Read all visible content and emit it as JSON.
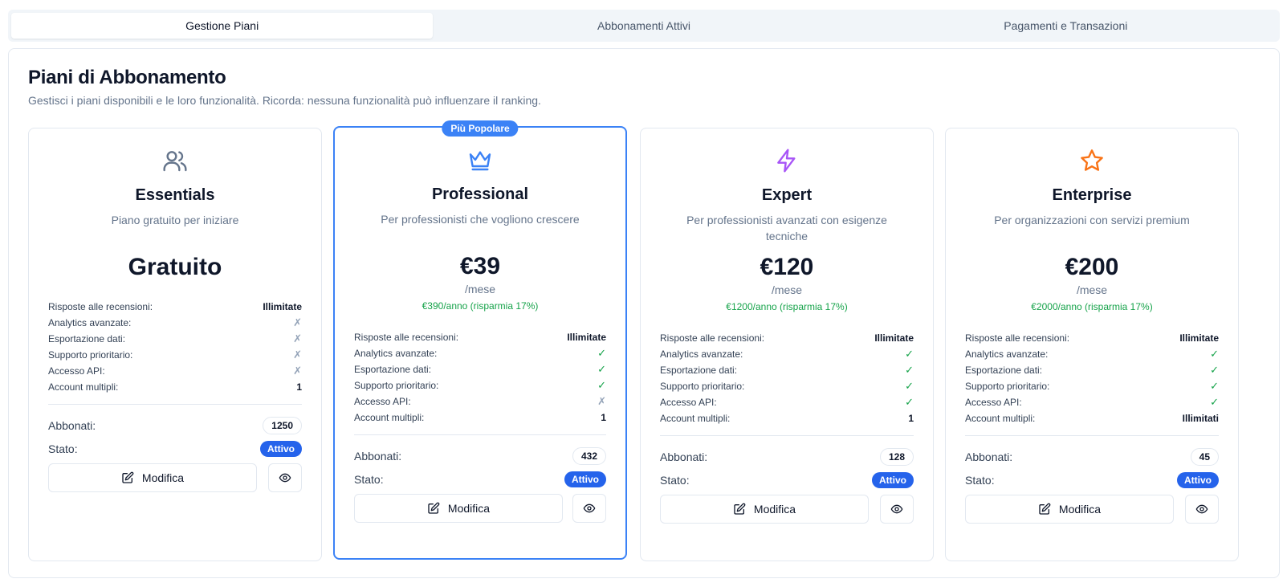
{
  "tabs": [
    {
      "label": "Gestione Piani",
      "active": true
    },
    {
      "label": "Abbonamenti Attivi",
      "active": false
    },
    {
      "label": "Pagamenti e Transazioni",
      "active": false
    }
  ],
  "page": {
    "title": "Piani di Abbonamento",
    "subtitle": "Gestisci i piani disponibili e le loro funzionalità. Ricorda: nessuna funzionalità può influenzare il ranking."
  },
  "labels": {
    "subscribers": "Abbonati:",
    "status": "Stato:",
    "edit_button": "Modifica",
    "popular_badge": "Più Popolare"
  },
  "colors": {
    "primary": "#2563eb",
    "popular_border": "#3b82f6",
    "yes": "#16a34a",
    "no": "#94a3b8"
  },
  "plans": [
    {
      "name": "Essentials",
      "icon": "users-icon",
      "icon_color": "#64748b",
      "description": "Piano gratuito per iniziare",
      "price": "Gratuito",
      "period": "",
      "yearly": "",
      "popular": false,
      "features": [
        {
          "label": "Risposte alle recensioni:",
          "value": "Illimitate",
          "type": "text"
        },
        {
          "label": "Analytics avanzate:",
          "value": "✗",
          "type": "no"
        },
        {
          "label": "Esportazione dati:",
          "value": "✗",
          "type": "no"
        },
        {
          "label": "Supporto prioritario:",
          "value": "✗",
          "type": "no"
        },
        {
          "label": "Accesso API:",
          "value": "✗",
          "type": "no"
        },
        {
          "label": "Account multipli:",
          "value": "1",
          "type": "text"
        }
      ],
      "subscribers": "1250",
      "status": "Attivo"
    },
    {
      "name": "Professional",
      "icon": "crown-icon",
      "icon_color": "#3b82f6",
      "description": "Per professionisti che vogliono crescere",
      "price": "€39",
      "period": "/mese",
      "yearly": "€390/anno (risparmia 17%)",
      "popular": true,
      "features": [
        {
          "label": "Risposte alle recensioni:",
          "value": "Illimitate",
          "type": "text"
        },
        {
          "label": "Analytics avanzate:",
          "value": "✓",
          "type": "yes"
        },
        {
          "label": "Esportazione dati:",
          "value": "✓",
          "type": "yes"
        },
        {
          "label": "Supporto prioritario:",
          "value": "✓",
          "type": "yes"
        },
        {
          "label": "Accesso API:",
          "value": "✗",
          "type": "no"
        },
        {
          "label": "Account multipli:",
          "value": "1",
          "type": "text"
        }
      ],
      "subscribers": "432",
      "status": "Attivo"
    },
    {
      "name": "Expert",
      "icon": "lightning-icon",
      "icon_color": "#a855f7",
      "description": "Per professionisti avanzati con esigenze tecniche",
      "price": "€120",
      "period": "/mese",
      "yearly": "€1200/anno (risparmia 17%)",
      "popular": false,
      "features": [
        {
          "label": "Risposte alle recensioni:",
          "value": "Illimitate",
          "type": "text"
        },
        {
          "label": "Analytics avanzate:",
          "value": "✓",
          "type": "yes"
        },
        {
          "label": "Esportazione dati:",
          "value": "✓",
          "type": "yes"
        },
        {
          "label": "Supporto prioritario:",
          "value": "✓",
          "type": "yes"
        },
        {
          "label": "Accesso API:",
          "value": "✓",
          "type": "yes"
        },
        {
          "label": "Account multipli:",
          "value": "1",
          "type": "text"
        }
      ],
      "subscribers": "128",
      "status": "Attivo"
    },
    {
      "name": "Enterprise",
      "icon": "star-icon",
      "icon_color": "#f97316",
      "description": "Per organizzazioni con servizi premium",
      "price": "€200",
      "period": "/mese",
      "yearly": "€2000/anno (risparmia 17%)",
      "popular": false,
      "features": [
        {
          "label": "Risposte alle recensioni:",
          "value": "Illimitate",
          "type": "text"
        },
        {
          "label": "Analytics avanzate:",
          "value": "✓",
          "type": "yes"
        },
        {
          "label": "Esportazione dati:",
          "value": "✓",
          "type": "yes"
        },
        {
          "label": "Supporto prioritario:",
          "value": "✓",
          "type": "yes"
        },
        {
          "label": "Accesso API:",
          "value": "✓",
          "type": "yes"
        },
        {
          "label": "Account multipli:",
          "value": "Illimitati",
          "type": "text"
        }
      ],
      "subscribers": "45",
      "status": "Attivo"
    }
  ]
}
